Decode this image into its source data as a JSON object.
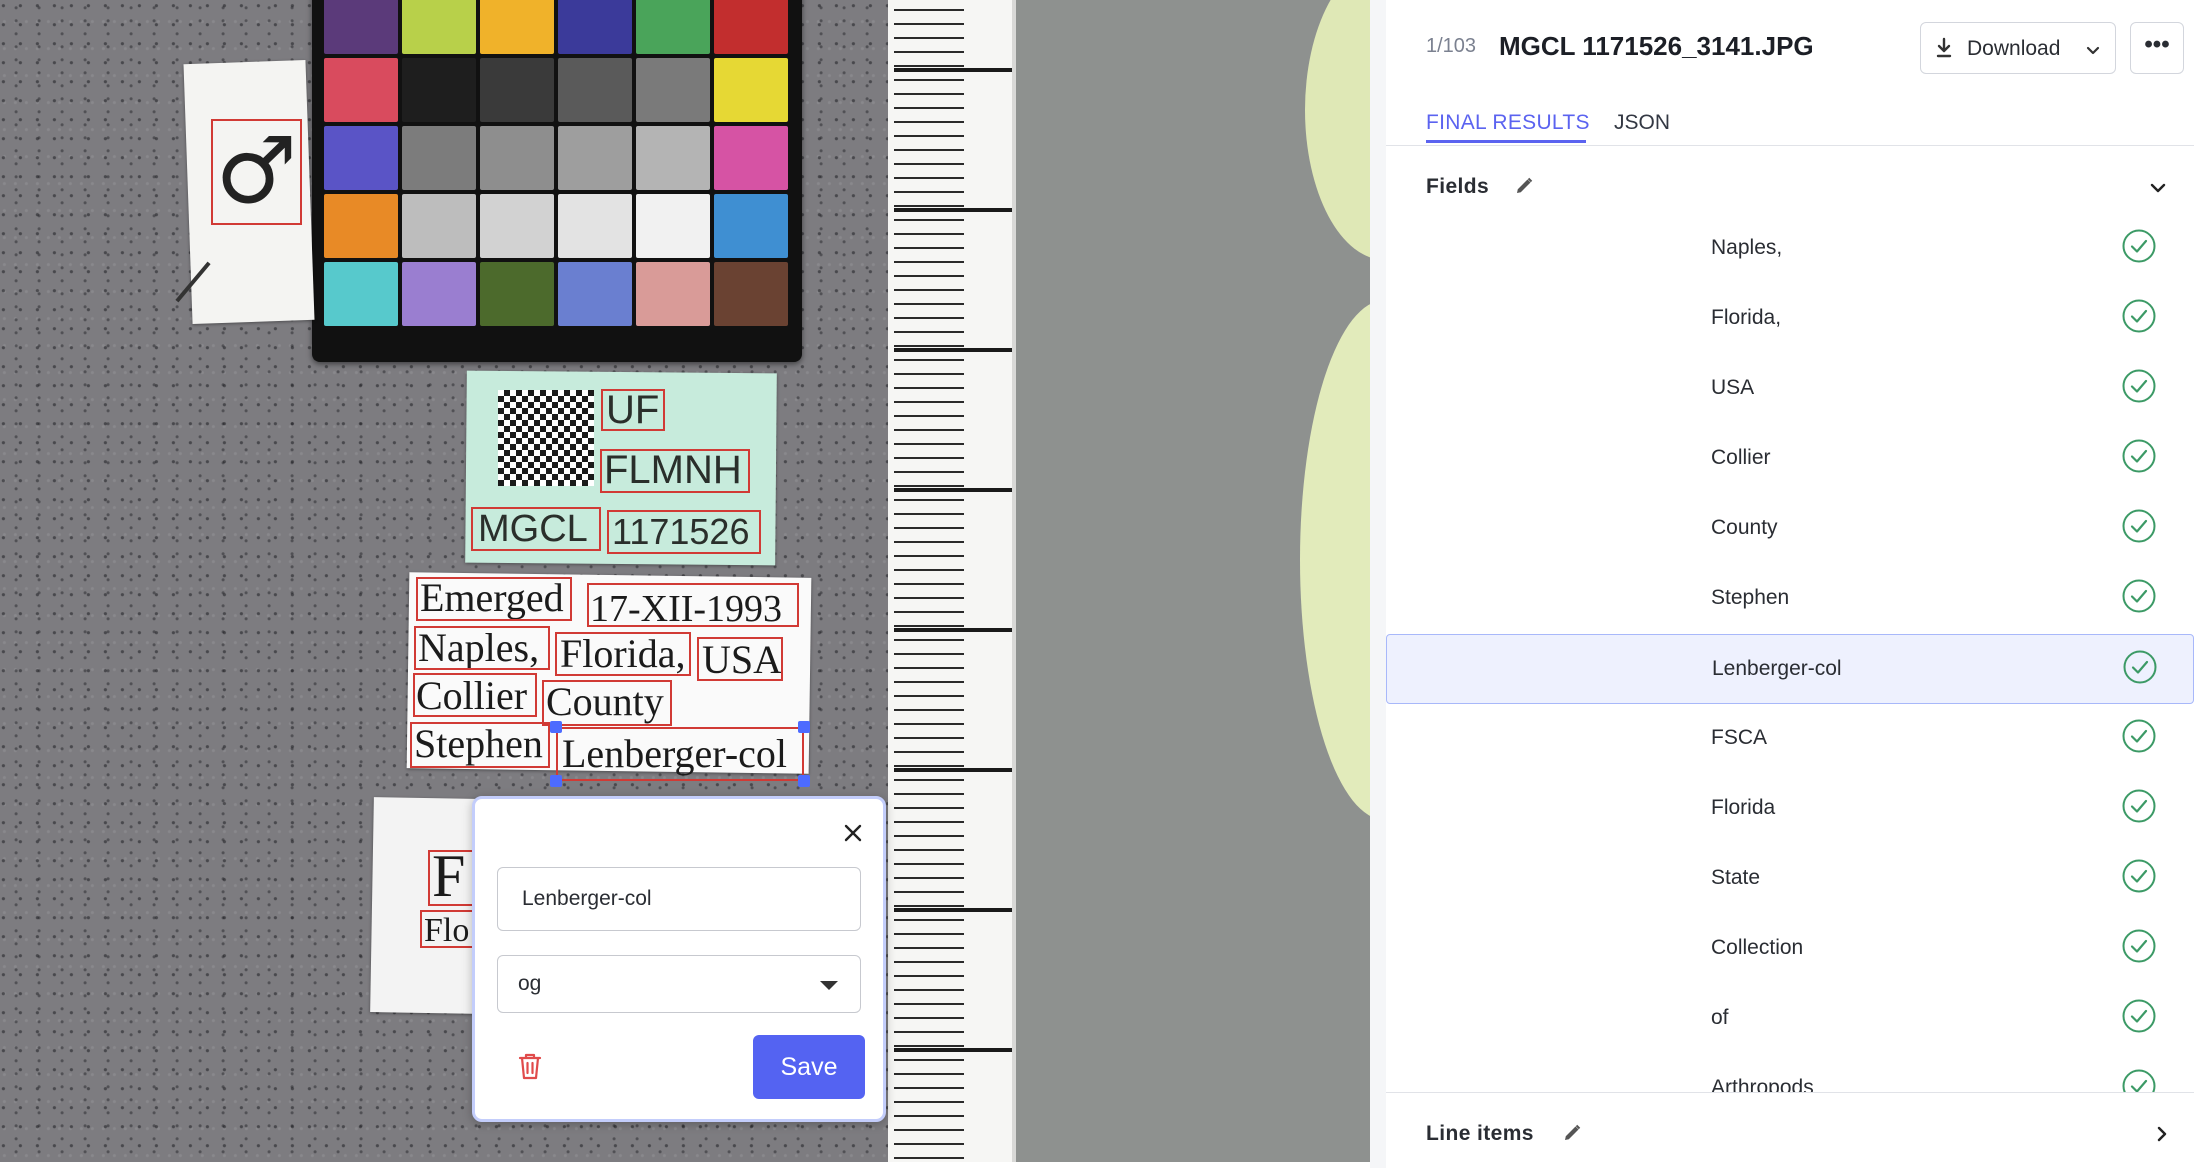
{
  "viewer": {
    "sex_symbol": "♂",
    "color_card": [
      "#5b3a7a",
      "#b8d04a",
      "#f0b22a",
      "#3b3a9a",
      "#4aa45a",
      "#c22e2e",
      "#d94b5e",
      "#1e1e1e",
      "#3a3a3a",
      "#5a5a5a",
      "#7a7a7a",
      "#e6d834",
      "#5a54c6",
      "#7c7c7c",
      "#8e8e8e",
      "#9e9e9e",
      "#b4b4b4",
      "#d653a4",
      "#e88a26",
      "#bdbdbd",
      "#d2d2d2",
      "#e3e3e3",
      "#f1f1f1",
      "#3f8fd2",
      "#57c9cc",
      "#9a7ed0",
      "#4c6a2c",
      "#6a7fd0",
      "#d99b98",
      "#6a4232"
    ],
    "specimen_words": {
      "uf": "UF",
      "flmnh": "FLMNH",
      "mgcl": "MGCL",
      "catalog": "1171526",
      "emerged": "Emerged",
      "date": "17-XII-1993",
      "naples": "Naples,",
      "florida": "Florida,",
      "usa": "USA",
      "collier": "Collier",
      "county": "County",
      "stephen": "Stephen",
      "lenberger": "Lenberger-col",
      "lower_1": "F",
      "lower_2": "Flo"
    }
  },
  "popup": {
    "text_value": "Lenberger-col",
    "select_value": "og",
    "save_label": "Save"
  },
  "header": {
    "counter": "1/103",
    "filename": "MGCL 1171526_3141.JPG",
    "download_label": "Download",
    "more_label": "•••"
  },
  "tabs": {
    "final": "FINAL RESULTS",
    "json": "JSON"
  },
  "fields": {
    "title": "Fields",
    "items": [
      {
        "label": "Naples,"
      },
      {
        "label": "Florida,"
      },
      {
        "label": "USA"
      },
      {
        "label": "Collier"
      },
      {
        "label": "County"
      },
      {
        "label": "Stephen"
      },
      {
        "label": "Lenberger-col"
      },
      {
        "label": "FSCA"
      },
      {
        "label": "Florida"
      },
      {
        "label": "State"
      },
      {
        "label": "Collection"
      },
      {
        "label": "of"
      },
      {
        "label": "Arthropods"
      }
    ],
    "selected_index": 6
  },
  "line_items": {
    "title": "Line items"
  },
  "colors": {
    "accent": "#5463f2",
    "check": "#3c9a66",
    "box": "#d13a35",
    "handle": "#4d6bff"
  }
}
